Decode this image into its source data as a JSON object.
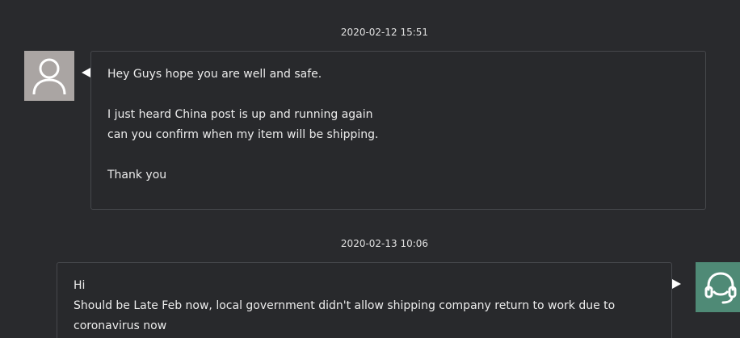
{
  "messages": [
    {
      "timestamp": "2020-02-12 15:51",
      "sender": "customer",
      "lines": [
        "Hey Guys hope you are well and safe.",
        "",
        "I just heard China post is up and running again",
        "can you confirm when my item will be shipping.",
        "",
        "Thank you"
      ]
    },
    {
      "timestamp": "2020-02-13 10:06",
      "sender": "support",
      "lines": [
        "Hi",
        "Should be Late Feb now, local government didn't allow shipping company return to work due to",
        "coronavirus now"
      ]
    }
  ],
  "icons": {
    "customer_avatar": "user-icon",
    "support_avatar": "headset-icon"
  },
  "colors": {
    "background": "#292a2d",
    "customer_avatar_bg": "#aaa5a3",
    "support_avatar_bg": "#4f8a76",
    "bubble_border": "#46484c"
  }
}
